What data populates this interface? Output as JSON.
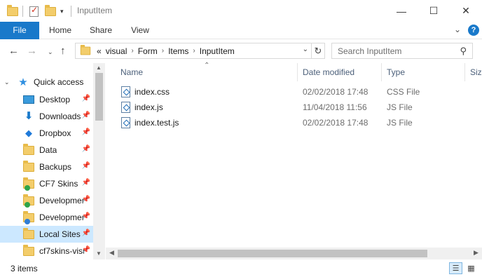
{
  "window": {
    "title": "InputItem",
    "controls": {
      "minimize": "—",
      "maximize": "☐",
      "close": "✕"
    }
  },
  "ribbon": {
    "tabs": [
      {
        "label": "File",
        "active": true
      },
      {
        "label": "Home"
      },
      {
        "label": "Share"
      },
      {
        "label": "View"
      }
    ],
    "help_label": "?"
  },
  "navigation": {
    "breadcrumb": {
      "overflow": "«",
      "items": [
        "visual",
        "Form",
        "Items",
        "InputItem"
      ]
    },
    "search_placeholder": "Search InputItem"
  },
  "sidebar": {
    "items": [
      {
        "label": "Quick access",
        "icon": "star-icon",
        "pinned": false,
        "expanded": true
      },
      {
        "label": "Desktop",
        "icon": "desktop-icon",
        "pinned": true
      },
      {
        "label": "Downloads",
        "icon": "download-icon",
        "pinned": true
      },
      {
        "label": "Dropbox",
        "icon": "dropbox-icon",
        "pinned": true
      },
      {
        "label": "Data",
        "icon": "folder-icon",
        "pinned": true
      },
      {
        "label": "Backups",
        "icon": "folder-icon",
        "pinned": true
      },
      {
        "label": "CF7 Skins",
        "icon": "folder-synced-icon",
        "pinned": true
      },
      {
        "label": "Developmer",
        "icon": "folder-synced-icon",
        "pinned": true
      },
      {
        "label": "Developmer",
        "icon": "folder-syncing-icon",
        "pinned": true
      },
      {
        "label": "Local Sites",
        "icon": "folder-icon",
        "pinned": true,
        "selected": true
      },
      {
        "label": "cf7skins-visu",
        "icon": "folder-icon",
        "pinned": true
      }
    ]
  },
  "file_list": {
    "columns": [
      "Name",
      "Date modified",
      "Type",
      "Siz"
    ],
    "rows": [
      {
        "name": "index.css",
        "date": "02/02/2018 17:48",
        "type": "CSS File"
      },
      {
        "name": "index.js",
        "date": "11/04/2018 11:56",
        "type": "JS File"
      },
      {
        "name": "index.test.js",
        "date": "02/02/2018 17:48",
        "type": "JS File"
      }
    ]
  },
  "status": {
    "item_count": "3 items"
  },
  "colors": {
    "accent": "#1979ca",
    "selected_bg": "#cce8ff",
    "column_header": "#4c607a",
    "secondary_text": "#6d6d6d"
  }
}
